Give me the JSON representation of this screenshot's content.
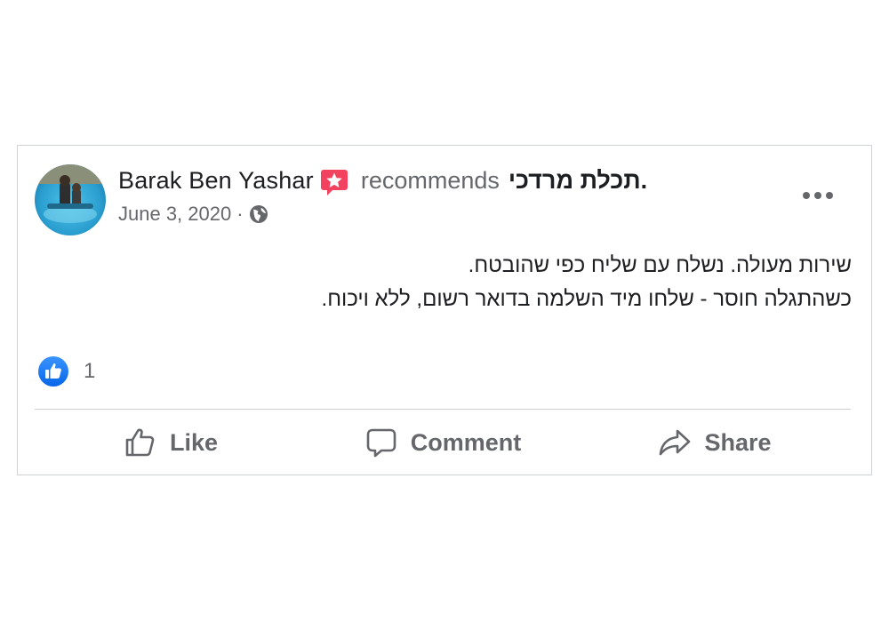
{
  "post": {
    "author_name": "Barak Ben Yashar",
    "recommends_text": "recommends",
    "page_name": "תכלת מרדכי",
    "page_name_suffix": ".",
    "date": "June 3, 2020",
    "meta_separator": "·",
    "body_lines": [
      "שירות מעולה. נשלח עם שליח כפי שהובטח.",
      "כשהתגלה חוסר - שלחו מיד השלמה בדואר רשום, ללא ויכוח."
    ],
    "reaction_count": "1"
  },
  "actions": {
    "like_label": "Like",
    "comment_label": "Comment",
    "share_label": "Share"
  },
  "icons": {
    "recommend_badge": "recommend-star-icon",
    "privacy": "globe-icon",
    "more": "more-options-icon",
    "reaction": "like-reaction-icon",
    "like": "thumbs-up-icon",
    "comment": "comment-bubble-icon",
    "share": "share-arrow-icon"
  },
  "colors": {
    "recommend_badge": "#f3425f",
    "like_reaction": "#1877f2",
    "secondary_text": "#65676b",
    "primary_text": "#1c1e21"
  }
}
